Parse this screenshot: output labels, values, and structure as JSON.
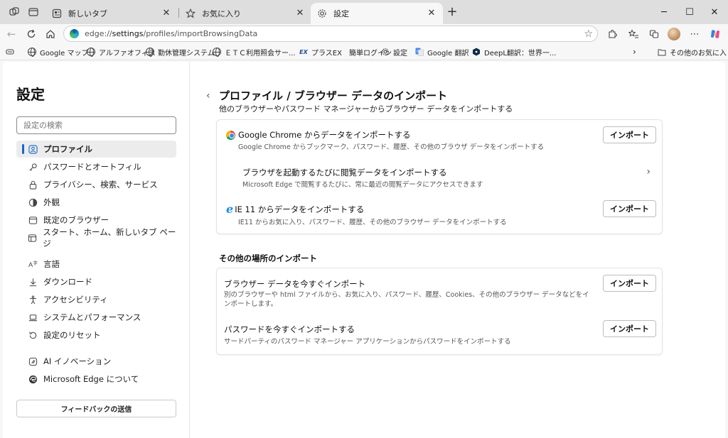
{
  "tabs": [
    {
      "title": "新しいタブ",
      "icon": "new-tab-page-icon",
      "active": false
    },
    {
      "title": "お気に入り",
      "icon": "star-icon",
      "active": false
    },
    {
      "title": "設定",
      "icon": "gear-icon",
      "active": true
    }
  ],
  "window_controls": {
    "minimize": "─",
    "maximize": "☐",
    "close": "✕"
  },
  "address": {
    "scheme": "edge://",
    "host": "settings",
    "path": "/profiles/importBrowsingData"
  },
  "favorites": [
    {
      "label": "Google マップ",
      "icon": "globe-icon"
    },
    {
      "label": "アルファオフィス",
      "icon": "globe-icon"
    },
    {
      "label": "勤休管理システム",
      "icon": "globe-icon"
    },
    {
      "label": "ＥＴＣ利用照会サー...",
      "icon": "globe-icon"
    },
    {
      "label": "プラスEX　簡単ログイン",
      "icon": "ex-logo-icon"
    },
    {
      "label": "設定",
      "icon": "gear-icon"
    },
    {
      "label": "Google 翻訳",
      "icon": "translate-icon"
    },
    {
      "label": "DeepL翻訳：世界一...",
      "icon": "deepl-icon"
    }
  ],
  "other_favorites": "その他のお気に入り",
  "sidebar": {
    "title": "設定",
    "search_placeholder": "設定の検索",
    "items": [
      {
        "label": "プロファイル",
        "icon": "profile-icon",
        "active": true
      },
      {
        "label": "パスワードとオートフィル",
        "icon": "key-icon"
      },
      {
        "label": "プライバシー、検索、サービス",
        "icon": "lock-icon"
      },
      {
        "label": "外観",
        "icon": "appearance-icon"
      },
      {
        "label": "既定のブラウザー",
        "icon": "browser-icon"
      },
      {
        "label": "スタート、ホーム、新しいタブ ページ",
        "icon": "home-page-icon"
      },
      {
        "label": "言語",
        "icon": "language-icon"
      },
      {
        "label": "ダウンロード",
        "icon": "download-icon"
      },
      {
        "label": "アクセシビリティ",
        "icon": "accessibility-icon"
      },
      {
        "label": "システムとパフォーマンス",
        "icon": "laptop-icon"
      },
      {
        "label": "設定のリセット",
        "icon": "reset-icon"
      },
      {
        "label": "AI イノベーション",
        "icon": "ai-icon"
      },
      {
        "label": "Microsoft Edge について",
        "icon": "edge-logo-icon"
      }
    ],
    "feedback_label": "フィードバックの送信"
  },
  "page": {
    "title": "プロファイル / ブラウザー データのインポート",
    "subtitle": "他のブラウザーやパスワード マネージャーからブラウザー データをインポートする",
    "card1": [
      {
        "title": "Google Chrome からデータをインポートする",
        "desc": "Google Chrome からブックマーク、パスワード、履歴、その他のブラウザ データをインポートする",
        "button": "インポート",
        "icon": "chrome-icon"
      },
      {
        "title": "ブラウザを起動するたびに閲覧データをインポートする",
        "desc": "Microsoft Edge で閲覧するたびに、常に最近の閲覧データにアクセスできます",
        "icon": "chevron-right-icon"
      },
      {
        "title": "IE 11 からデータをインポートする",
        "desc": "IE11 からお気に入り、パスワード、履歴、その他のブラウザー データをインポートする",
        "button": "インポート",
        "icon": "ie-icon"
      }
    ],
    "section_title": "その他の場所のインポート",
    "card2": [
      {
        "title": "ブラウザー データを今すぐインポート",
        "desc": "別のブラウザーや html ファイルから、お気に入り、パスワード、履歴、Cookies、その他のブラウザー データなどをインポートします。",
        "button": "インポート"
      },
      {
        "title": "パスワードを今すぐインポートする",
        "desc": "サードパーティのパスワード マネージャー アプリケーションからパスワードをインポートする",
        "button": "インポート"
      }
    ]
  },
  "colors": {
    "accent": "#1766c7",
    "frame": "#dedede",
    "toolbar": "#f7f7f7"
  }
}
